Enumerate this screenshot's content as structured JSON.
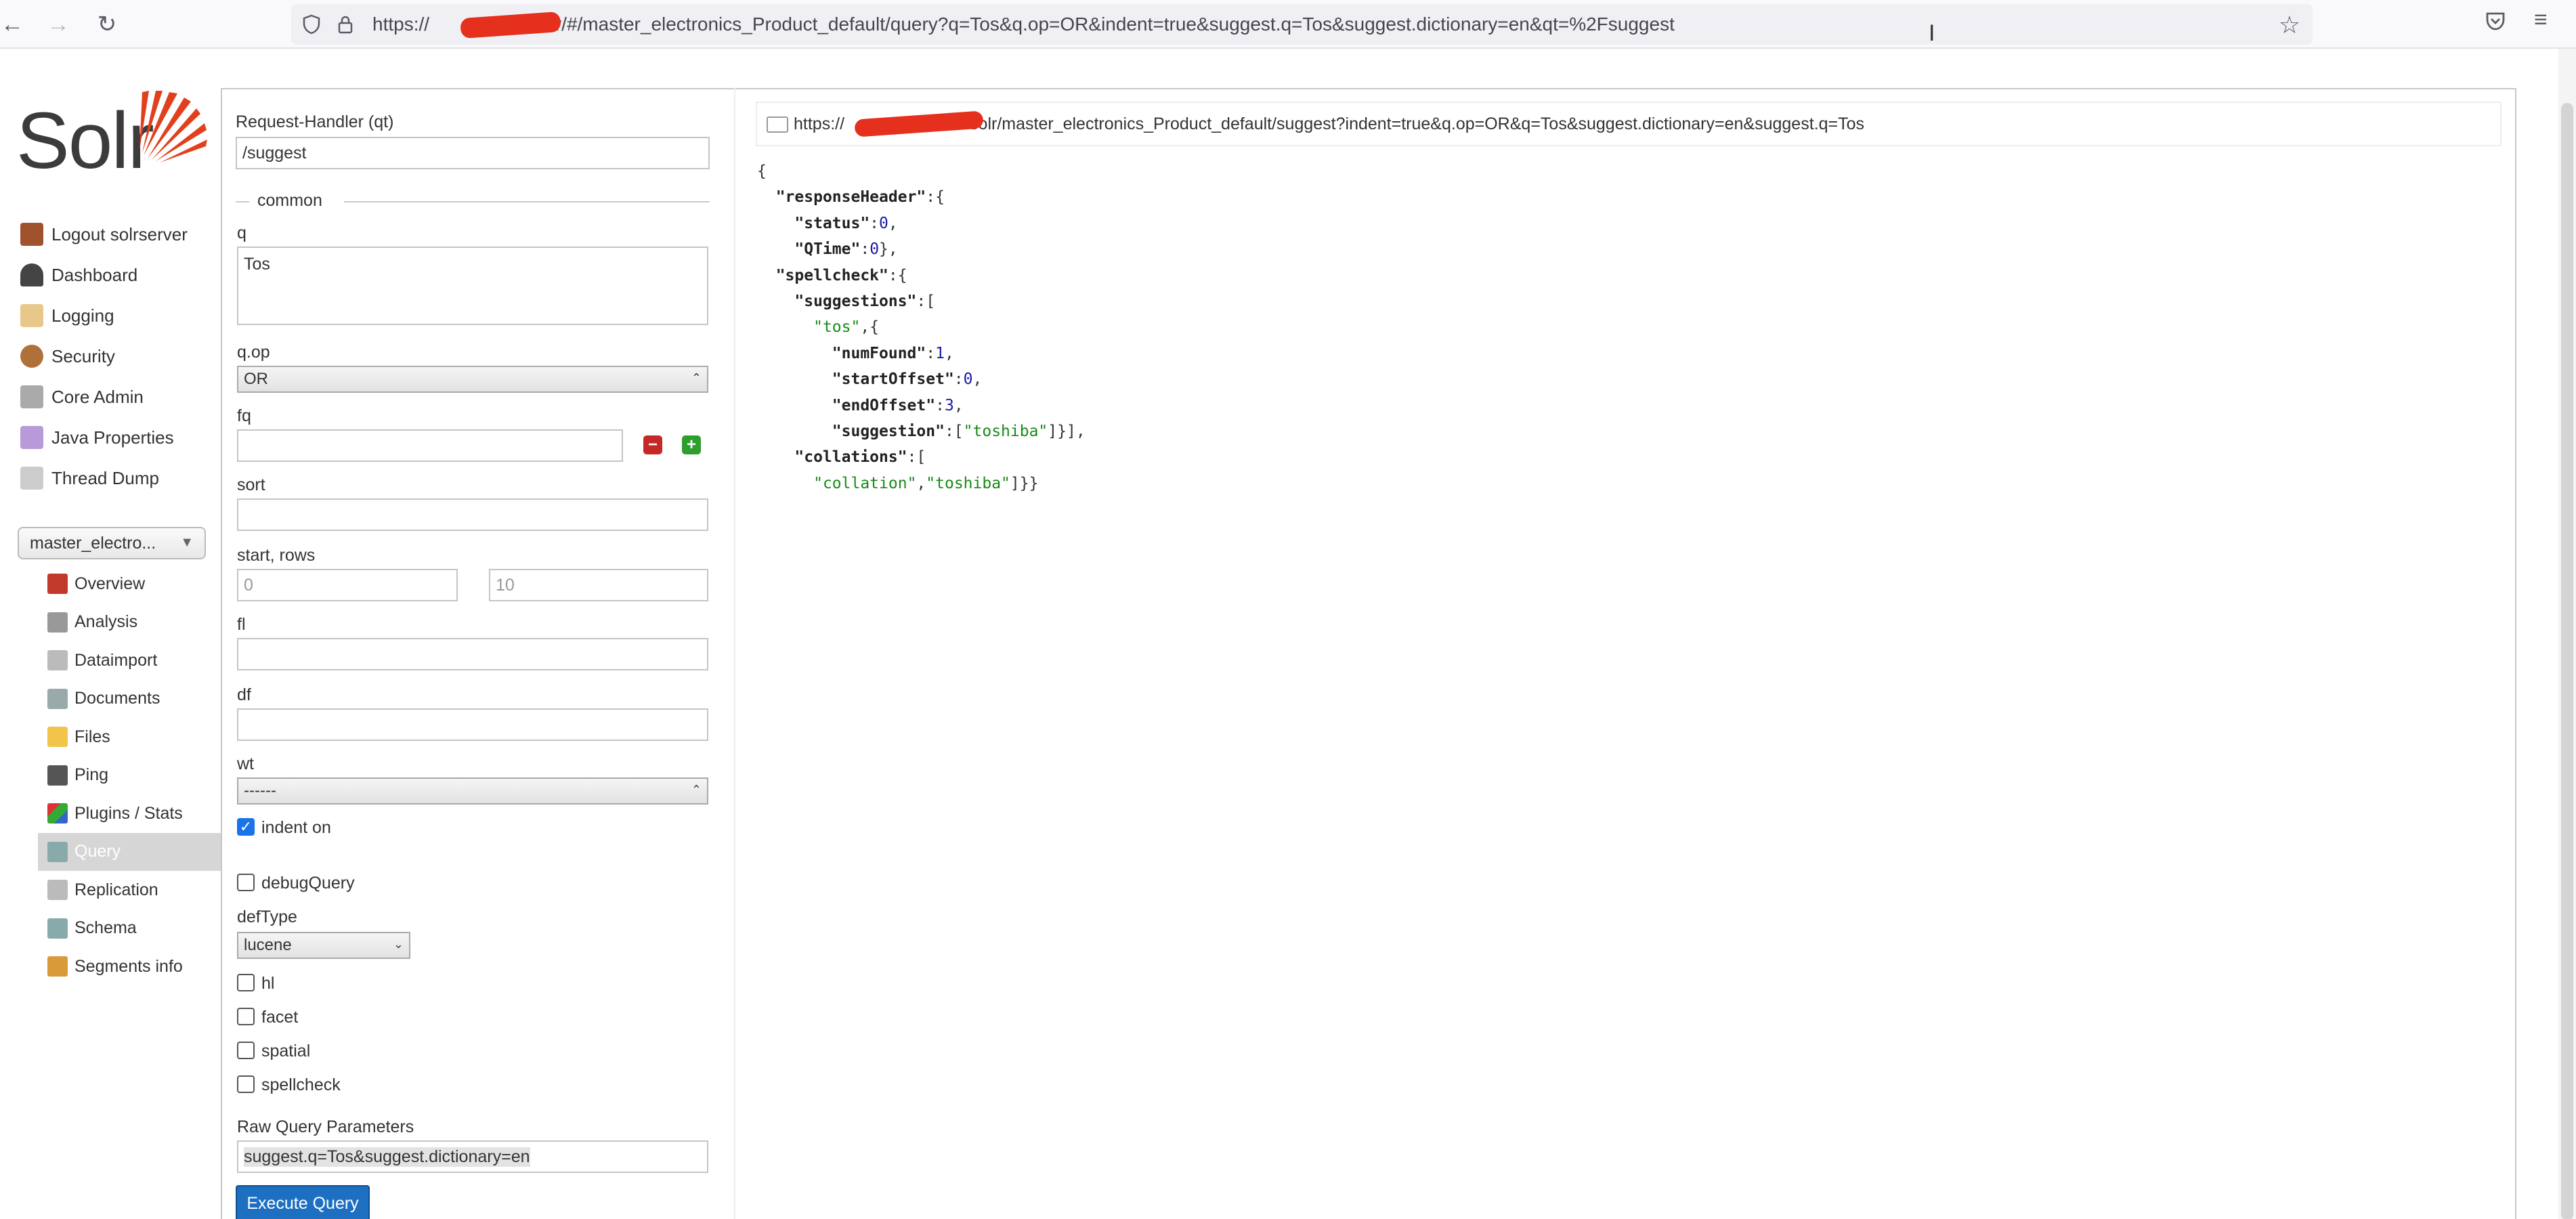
{
  "browser": {
    "url_prefix": "https://",
    "url_rest": "solr/#/master_electronics_Product_default/query?q=Tos&q.op=OR&indent=true&suggest.q=Tos&suggest.dictionary=en&qt=%2Fsuggest",
    "back_icon": "←",
    "forward_icon": "→",
    "reload_icon": "↻",
    "star_icon": "☆",
    "menu_icon": "≡"
  },
  "sidebar": {
    "logo": "Solr",
    "menu": [
      {
        "label": "Logout solrserver",
        "icon": "logout-icon"
      },
      {
        "label": "Dashboard",
        "icon": "dashboard-icon"
      },
      {
        "label": "Logging",
        "icon": "logging-icon"
      },
      {
        "label": "Security",
        "icon": "security-icon"
      },
      {
        "label": "Core Admin",
        "icon": "core-admin-icon"
      },
      {
        "label": "Java Properties",
        "icon": "java-properties-icon"
      },
      {
        "label": "Thread Dump",
        "icon": "thread-dump-icon"
      }
    ],
    "core_selector": "master_electro...",
    "core_menu": [
      {
        "label": "Overview",
        "icon": "home-icon"
      },
      {
        "label": "Analysis",
        "icon": "funnel-icon"
      },
      {
        "label": "Dataimport",
        "icon": "dataimport-icon"
      },
      {
        "label": "Documents",
        "icon": "documents-icon"
      },
      {
        "label": "Files",
        "icon": "folder-icon"
      },
      {
        "label": "Ping",
        "icon": "ping-icon"
      },
      {
        "label": "Plugins / Stats",
        "icon": "plugins-icon"
      },
      {
        "label": "Query",
        "icon": "magnifier-icon"
      },
      {
        "label": "Replication",
        "icon": "replication-icon"
      },
      {
        "label": "Schema",
        "icon": "schema-icon"
      },
      {
        "label": "Segments info",
        "icon": "segments-icon"
      }
    ]
  },
  "form": {
    "qt_label": "Request-Handler (qt)",
    "qt_value": "/suggest",
    "common_legend": "common",
    "q_label": "q",
    "q_value": "Tos",
    "qop_label": "q.op",
    "qop_value": "OR",
    "fq_label": "fq",
    "fq_value": "",
    "sort_label": "sort",
    "sort_value": "",
    "startrows_label": "start, rows",
    "start_placeholder": "0",
    "rows_placeholder": "10",
    "fl_label": "fl",
    "df_label": "df",
    "wt_label": "wt",
    "wt_value": "------",
    "indent_label": "indent on",
    "debug_label": "debugQuery",
    "deftype_label": "defType",
    "deftype_value": "lucene",
    "hl_label": "hl",
    "facet_label": "facet",
    "spatial_label": "spatial",
    "spellcheck_label": "spellcheck",
    "raw_label": "Raw Query Parameters",
    "raw_value": "suggest.q=Tos&suggest.dictionary=en",
    "execute_label": "Execute Query"
  },
  "response": {
    "url_prefix": "https://",
    "url_rest": "solr/master_electronics_Product_default/suggest?indent=true&q.op=OR&q=Tos&suggest.dictionary=en&suggest.q=Tos",
    "lines": [
      {
        "parts": [
          {
            "t": "{",
            "c": ""
          }
        ]
      },
      {
        "indent": 1,
        "parts": [
          {
            "t": "\"responseHeader\"",
            "c": "k"
          },
          {
            "t": ":{",
            "c": ""
          }
        ]
      },
      {
        "indent": 2,
        "parts": [
          {
            "t": "\"status\"",
            "c": "k"
          },
          {
            "t": ":",
            "c": ""
          },
          {
            "t": "0",
            "c": "n"
          },
          {
            "t": ",",
            "c": ""
          }
        ]
      },
      {
        "indent": 2,
        "parts": [
          {
            "t": "\"QTime\"",
            "c": "k"
          },
          {
            "t": ":",
            "c": ""
          },
          {
            "t": "0",
            "c": "n"
          },
          {
            "t": "},",
            "c": ""
          }
        ]
      },
      {
        "indent": 1,
        "parts": [
          {
            "t": "\"spellcheck\"",
            "c": "k"
          },
          {
            "t": ":{",
            "c": ""
          }
        ]
      },
      {
        "indent": 2,
        "parts": [
          {
            "t": "\"suggestions\"",
            "c": "k"
          },
          {
            "t": ":[",
            "c": ""
          }
        ]
      },
      {
        "indent": 3,
        "parts": [
          {
            "t": "\"tos\"",
            "c": "s"
          },
          {
            "t": ",{",
            "c": ""
          }
        ]
      },
      {
        "indent": 4,
        "parts": [
          {
            "t": "\"numFound\"",
            "c": "k"
          },
          {
            "t": ":",
            "c": ""
          },
          {
            "t": "1",
            "c": "n"
          },
          {
            "t": ",",
            "c": ""
          }
        ]
      },
      {
        "indent": 4,
        "parts": [
          {
            "t": "\"startOffset\"",
            "c": "k"
          },
          {
            "t": ":",
            "c": ""
          },
          {
            "t": "0",
            "c": "n"
          },
          {
            "t": ",",
            "c": ""
          }
        ]
      },
      {
        "indent": 4,
        "parts": [
          {
            "t": "\"endOffset\"",
            "c": "k"
          },
          {
            "t": ":",
            "c": ""
          },
          {
            "t": "3",
            "c": "n"
          },
          {
            "t": ",",
            "c": ""
          }
        ]
      },
      {
        "indent": 4,
        "parts": [
          {
            "t": "\"suggestion\"",
            "c": "k"
          },
          {
            "t": ":[",
            "c": ""
          },
          {
            "t": "\"toshiba\"",
            "c": "s"
          },
          {
            "t": "]}],",
            "c": ""
          }
        ]
      },
      {
        "indent": 2,
        "parts": [
          {
            "t": "\"collations\"",
            "c": "k"
          },
          {
            "t": ":[",
            "c": ""
          }
        ]
      },
      {
        "indent": 3,
        "parts": [
          {
            "t": "\"collation\"",
            "c": "s"
          },
          {
            "t": ",",
            "c": ""
          },
          {
            "t": "\"toshiba\"",
            "c": "s"
          },
          {
            "t": "]}}",
            "c": ""
          }
        ]
      }
    ]
  },
  "colors": {
    "accent": "#1d6fc2",
    "string": "#178a17",
    "number": "#1a1aa6",
    "redaction": "#e5301e"
  }
}
